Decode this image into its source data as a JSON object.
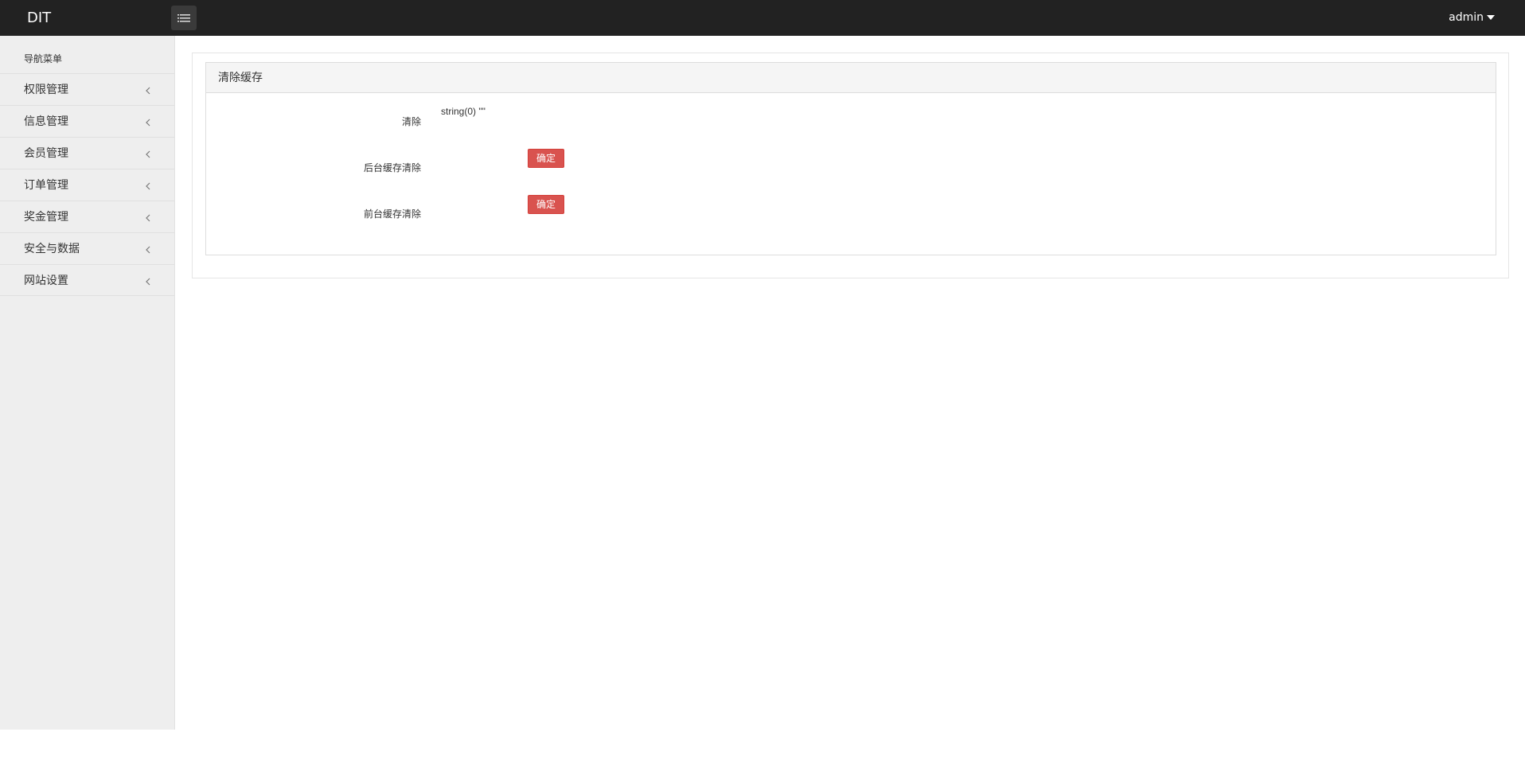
{
  "header": {
    "brand": "DIT",
    "user": "admin"
  },
  "sidebar": {
    "header": "导航菜单",
    "items": [
      {
        "label": "权限管理"
      },
      {
        "label": "信息管理"
      },
      {
        "label": "会员管理"
      },
      {
        "label": "订单管理"
      },
      {
        "label": "奖金管理"
      },
      {
        "label": "安全与数据"
      },
      {
        "label": "网站设置"
      }
    ]
  },
  "panel": {
    "title": "清除缓存",
    "rows": [
      {
        "label": "清除",
        "value": "string(0) \"\""
      },
      {
        "label": "后台缓存清除",
        "button": "确定"
      },
      {
        "label": "前台缓存清除",
        "button": "确定"
      }
    ]
  },
  "colors": {
    "topbar": "#222222",
    "sidebar": "#eeeeee",
    "danger": "#d9534f"
  }
}
